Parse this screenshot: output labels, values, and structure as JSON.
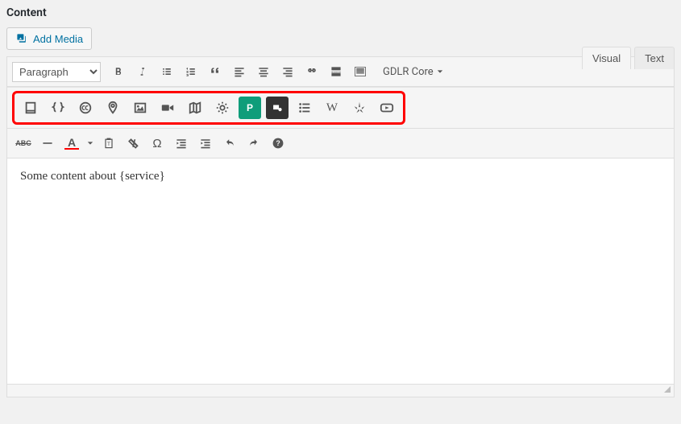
{
  "section": {
    "label": "Content"
  },
  "media_button": {
    "label": "Add Media"
  },
  "tabs": {
    "visual": "Visual",
    "text": "Text"
  },
  "toolbar": {
    "format_select": "Paragraph",
    "gdlr_label": "GDLR Core"
  },
  "editor": {
    "content": "Some content about {service}"
  }
}
